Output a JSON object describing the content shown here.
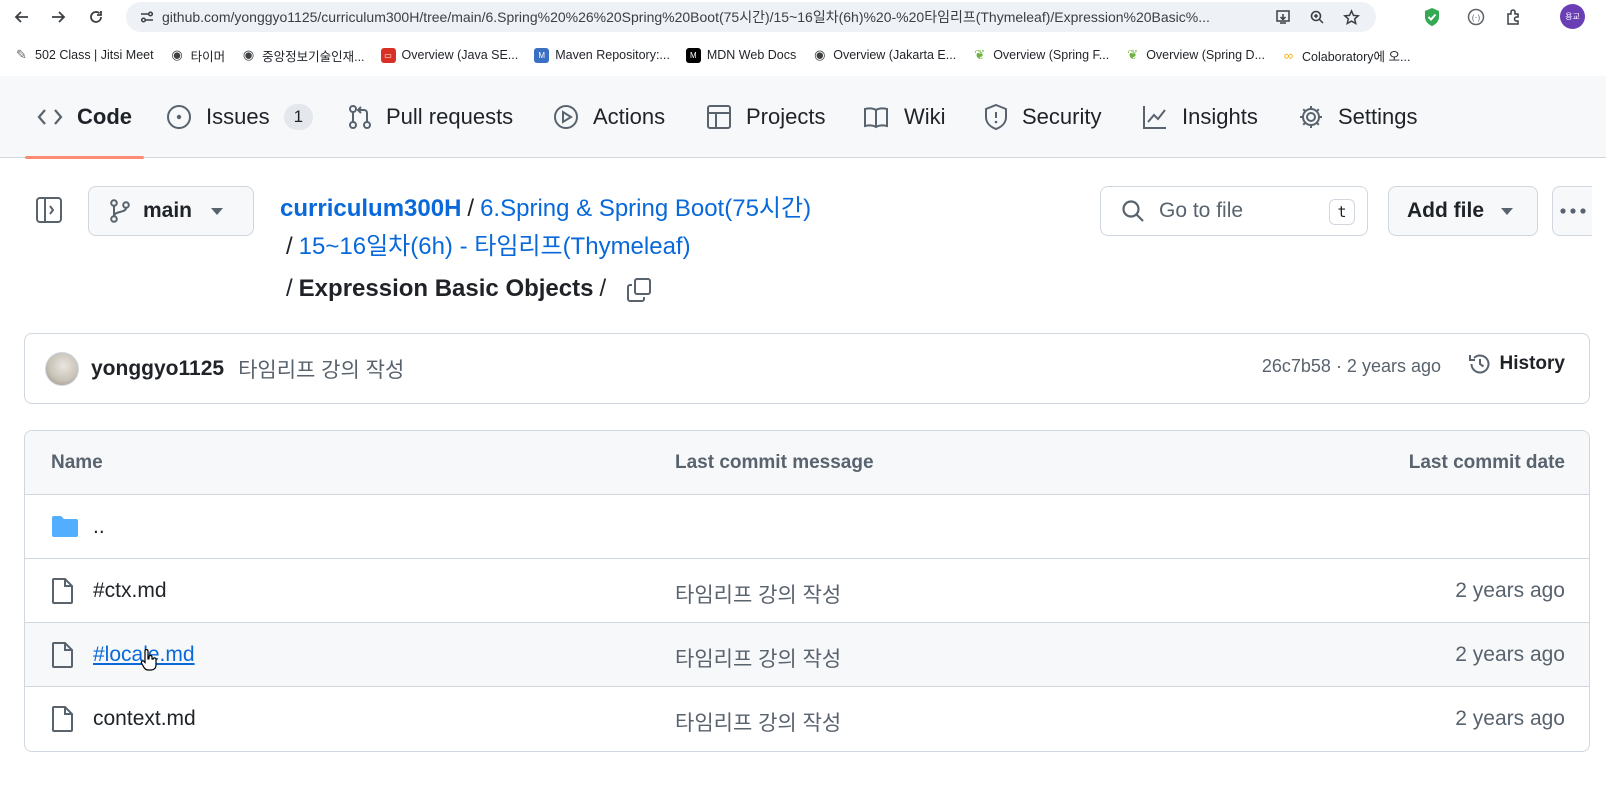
{
  "browser": {
    "url": "github.com/yonggyo1125/curriculum300H/tree/main/6.Spring%20%26%20Spring%20Boot(75시간)/15~16일차(6h)%20-%20타임리프(Thymeleaf)/Expression%20Basic%...",
    "profile_initials": "용교",
    "bookmarks": [
      {
        "label": "502 Class | Jitsi Meet",
        "icon": "jitsi-icon",
        "color": "#5f6368"
      },
      {
        "label": "타이머",
        "icon": "globe-icon",
        "color": "#3c4043"
      },
      {
        "label": "중앙정보기술인재...",
        "icon": "globe-icon",
        "color": "#3c4043"
      },
      {
        "label": "Overview (Java SE...",
        "icon": "oracle-icon",
        "color": "#d93025"
      },
      {
        "label": "Maven Repository:...",
        "icon": "maven-icon",
        "color": "#3a6fc4"
      },
      {
        "label": "MDN Web Docs",
        "icon": "mdn-icon",
        "color": "#000000"
      },
      {
        "label": "Overview (Jakarta E...",
        "icon": "globe-icon",
        "color": "#3c4043"
      },
      {
        "label": "Overview (Spring F...",
        "icon": "spring-icon",
        "color": "#6db33f"
      },
      {
        "label": "Overview (Spring D...",
        "icon": "spring-icon",
        "color": "#6db33f"
      },
      {
        "label": "Colaboratory에 오...",
        "icon": "colab-icon",
        "color": "#f9ab00"
      }
    ]
  },
  "repo_nav": {
    "tabs": [
      {
        "label": "Code",
        "icon": "code-icon",
        "active": true
      },
      {
        "label": "Issues",
        "icon": "issue-icon",
        "count": "1"
      },
      {
        "label": "Pull requests",
        "icon": "pull-request-icon"
      },
      {
        "label": "Actions",
        "icon": "play-icon"
      },
      {
        "label": "Projects",
        "icon": "table-icon"
      },
      {
        "label": "Wiki",
        "icon": "book-icon"
      },
      {
        "label": "Security",
        "icon": "shield-icon"
      },
      {
        "label": "Insights",
        "icon": "graph-icon"
      },
      {
        "label": "Settings",
        "icon": "gear-icon"
      }
    ]
  },
  "header": {
    "branch": "main",
    "breadcrumb": {
      "repo": "curriculum300H",
      "level1": "6.Spring & Spring Boot(75시간)",
      "level2": "15~16일차(6h) - 타임리프(Thymeleaf)",
      "current": "Expression Basic Objects",
      "separator": "/"
    },
    "goto_placeholder": "Go to file",
    "goto_shortcut": "t",
    "add_file_label": "Add file"
  },
  "latest_commit": {
    "author": "yonggyo1125",
    "message": "타임리프 강의 작성",
    "meta": "26c7b58 · 2 years ago",
    "history_label": "History"
  },
  "file_table": {
    "columns": [
      "Name",
      "Last commit message",
      "Last commit date"
    ],
    "parent_dir": "..",
    "rows": [
      {
        "name": "#ctx.md",
        "message": "타임리프 강의 작성",
        "date": "2 years ago"
      },
      {
        "name": "#locale.md",
        "message": "타임리프 강의 작성",
        "date": "2 years ago"
      },
      {
        "name": "context.md",
        "message": "타임리프 강의 작성",
        "date": "2 years ago"
      }
    ]
  },
  "colors": {
    "link": "#0969da",
    "tab_underline": "#fd8c73",
    "folder": "#54aeff",
    "muted_text": "#59636e",
    "border": "#d0d7de"
  }
}
